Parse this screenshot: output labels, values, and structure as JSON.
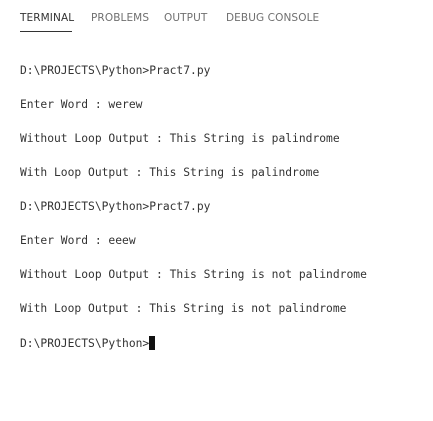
{
  "tabs": [
    {
      "label": "TERMINAL",
      "active": true
    },
    {
      "label": "PROBLEMS",
      "active": false
    },
    {
      "label": "OUTPUT",
      "active": false
    },
    {
      "label": "DEBUG CONSOLE",
      "active": false
    }
  ],
  "terminal": {
    "lines": [
      "D:\\PROJECTS\\Python>Pract7.py",
      "Enter Word : werew",
      "Without Loop Output : This String is palindrome",
      "With Loop Output : This String is palindrome",
      "D:\\PROJECTS\\Python>Pract7.py",
      "Enter Word : eeew",
      "Without Loop Output : This String is not palindrome",
      "With Loop Output : This String is not palindrome"
    ],
    "prompt": "D:\\PROJECTS\\Python>"
  },
  "colors": {
    "background": "#ffffff",
    "text": "#333333",
    "inactive_tab": "#6f6f6f",
    "cursor": "#111111"
  }
}
